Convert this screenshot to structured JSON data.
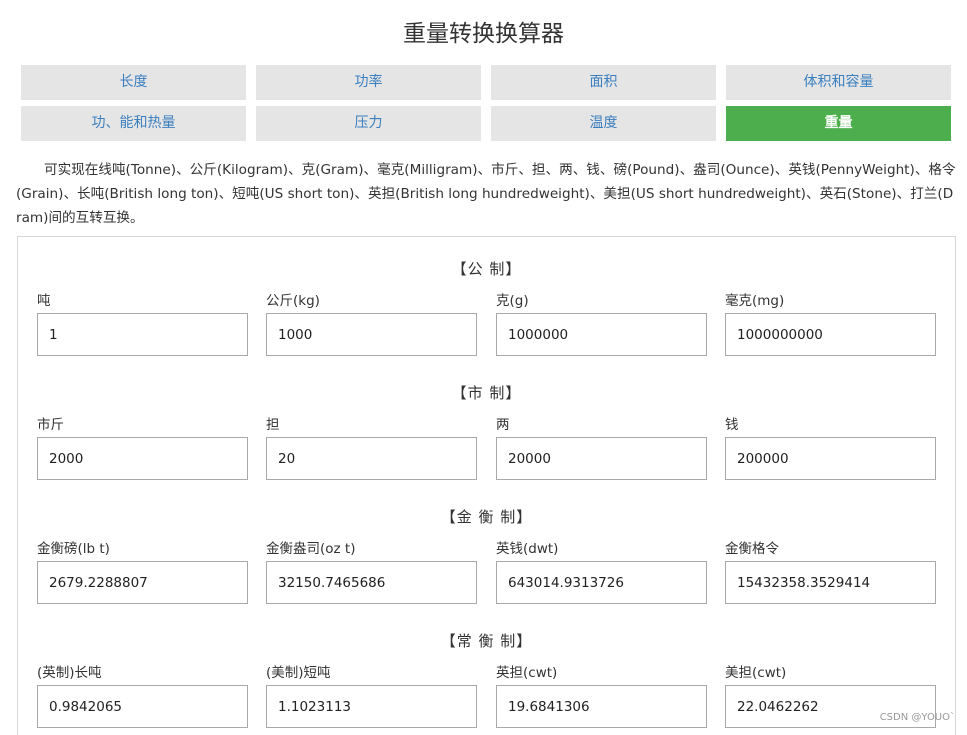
{
  "title": "重量转换换算器",
  "nav": [
    {
      "label": "长度",
      "active": false
    },
    {
      "label": "功率",
      "active": false
    },
    {
      "label": "面积",
      "active": false
    },
    {
      "label": "体积和容量",
      "active": false
    },
    {
      "label": "功、能和热量",
      "active": false
    },
    {
      "label": "压力",
      "active": false
    },
    {
      "label": "温度",
      "active": false
    },
    {
      "label": "重量",
      "active": true
    }
  ],
  "description": "可实现在线吨(Tonne)、公斤(Kilogram)、克(Gram)、毫克(Milligram)、市斤、担、两、钱、磅(Pound)、盎司(Ounce)、英钱(PennyWeight)、格令(Grain)、长吨(British long ton)、短吨(US short ton)、英担(British long hundredweight)、美担(US short hundredweight)、英石(Stone)、打兰(Dram)间的互转互换。",
  "sections": [
    {
      "title": "【公 制】",
      "fields": [
        {
          "label": "吨",
          "value": "1"
        },
        {
          "label": "公斤(kg)",
          "value": "1000"
        },
        {
          "label": "克(g)",
          "value": "1000000"
        },
        {
          "label": "毫克(mg)",
          "value": "1000000000"
        }
      ]
    },
    {
      "title": "【市 制】",
      "fields": [
        {
          "label": "市斤",
          "value": "2000"
        },
        {
          "label": "担",
          "value": "20"
        },
        {
          "label": "两",
          "value": "20000"
        },
        {
          "label": "钱",
          "value": "200000"
        }
      ]
    },
    {
      "title": "【金 衡 制】",
      "fields": [
        {
          "label": "金衡磅(lb t)",
          "value": "2679.2288807"
        },
        {
          "label": "金衡盎司(oz t)",
          "value": "32150.7465686"
        },
        {
          "label": "英钱(dwt)",
          "value": "643014.9313726"
        },
        {
          "label": "金衡格令",
          "value": "15432358.3529414"
        }
      ]
    },
    {
      "title": "【常 衡 制】",
      "fields": [
        {
          "label": "(英制)长吨",
          "value": "0.9842065"
        },
        {
          "label": "(美制)短吨",
          "value": "1.1023113"
        },
        {
          "label": "英担(cwt)",
          "value": "19.6841306"
        },
        {
          "label": "美担(cwt)",
          "value": "22.0462262"
        }
      ]
    }
  ],
  "watermark": "CSDN @YOUO`"
}
